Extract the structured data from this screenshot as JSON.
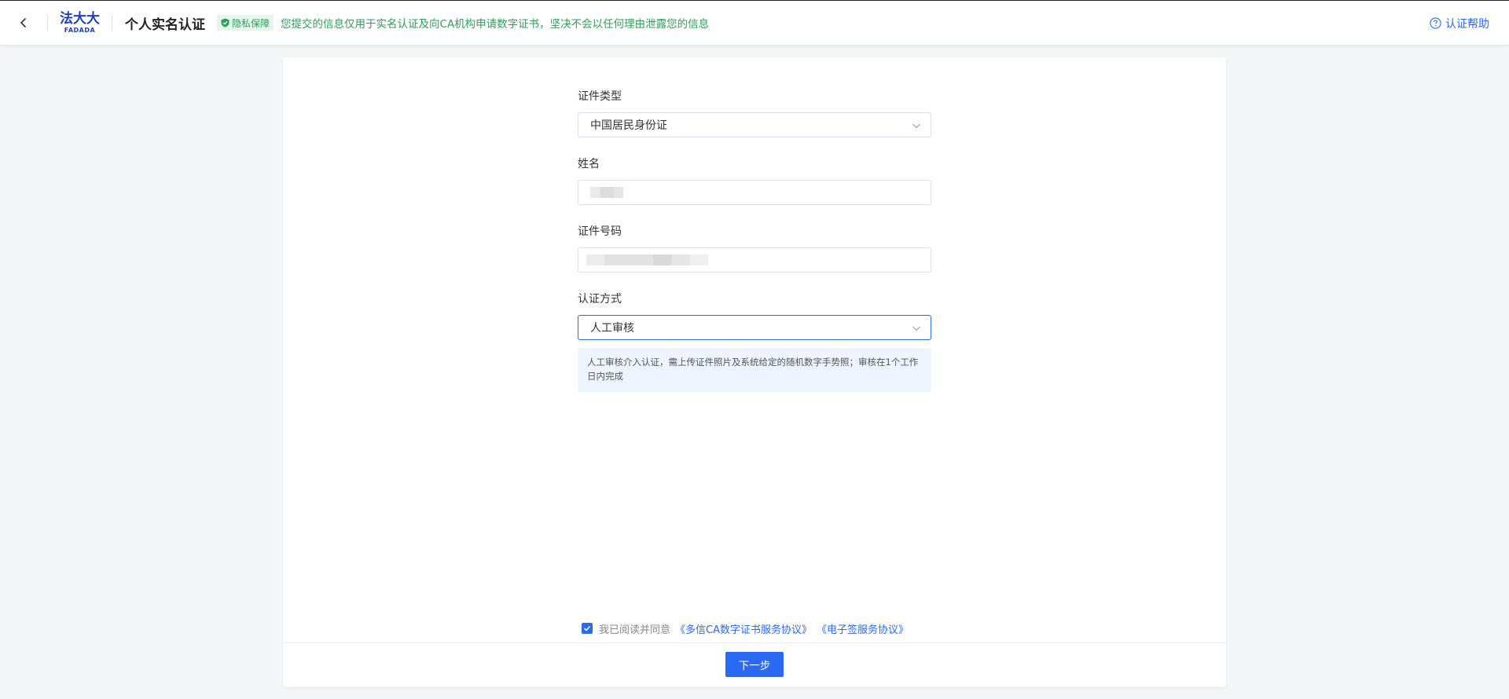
{
  "header": {
    "logo_cn": "法大大",
    "logo_en": "FADADA",
    "title": "个人实名认证",
    "privacy_badge": "隐私保障",
    "privacy_text": "您提交的信息仅用于实名认证及向CA机构申请数字证书，坚决不会以任何理由泄露您的信息",
    "help_label": "认证帮助"
  },
  "form": {
    "id_type": {
      "label": "证件类型",
      "value": "中国居民身份证"
    },
    "name": {
      "label": "姓名"
    },
    "id_number": {
      "label": "证件号码"
    },
    "auth_method": {
      "label": "认证方式",
      "value": "人工审核"
    },
    "tip": "人工审核介入认证，需上传证件照片及系统给定的随机数字手势照；审核在1个工作日内完成"
  },
  "agreement": {
    "prefix": "我已阅读并同意",
    "link1": "《多信CA数字证书服务协议》",
    "link2": "《电子签服务协议》",
    "checked": true
  },
  "next_button": "下一步",
  "colors": {
    "accent": "#2a6af2",
    "privacy_green": "#2e9e58",
    "logo_blue": "#1d3fbf"
  }
}
